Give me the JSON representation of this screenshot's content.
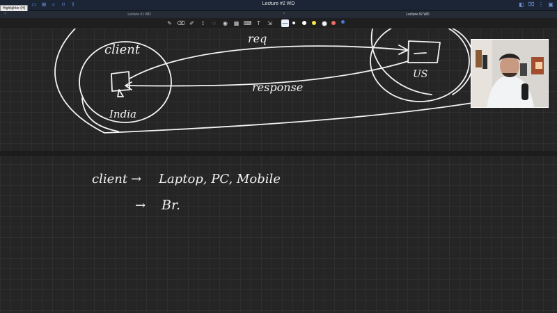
{
  "window": {
    "title": "Lecture #2 WD",
    "tooltip": "Highlighter (H)"
  },
  "tabs": [
    {
      "label": "Lecture #1 WD"
    },
    {
      "label": "Lecture #2 WD"
    }
  ],
  "toolbar": {
    "tools": [
      "pen-icon",
      "eraser-icon",
      "highlighter-icon",
      "lasso-icon",
      "shapes-icon",
      "stamp-icon",
      "image-icon",
      "keyboard-icon",
      "text-icon",
      "link-icon",
      "pen-thickness-icon"
    ],
    "colors": [
      "#ffffff",
      "#ffffff",
      "#f2e64a",
      "#f4f4f4",
      "#f06a6a",
      "#4a78d8"
    ]
  },
  "whiteboard": {
    "labels": {
      "client_top": "client",
      "india": "India",
      "us": "US",
      "req": "req",
      "response": "response",
      "client_line": "client",
      "devices": "Laptop, PC, Mobile",
      "browser": "Br."
    },
    "arrows": {
      "arrow1": "→",
      "arrow2": "→"
    }
  }
}
